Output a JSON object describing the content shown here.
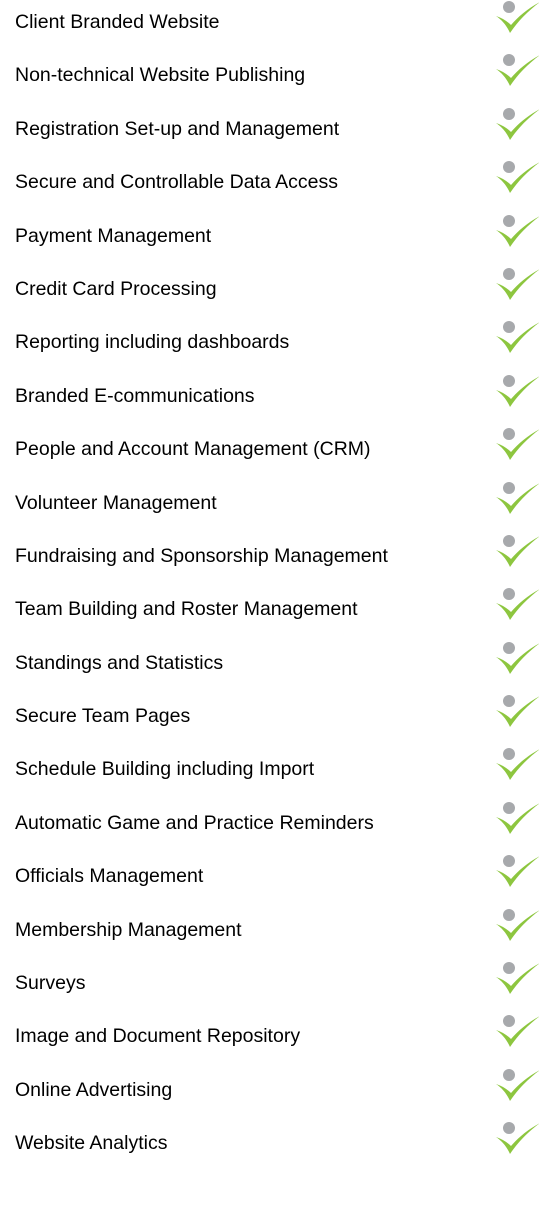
{
  "features": {
    "items": [
      {
        "label": "Client Branded Website",
        "icon": "check-icon"
      },
      {
        "label": "Non-technical Website Publishing",
        "icon": "check-icon"
      },
      {
        "label": "Registration Set-up and Management",
        "icon": "check-icon"
      },
      {
        "label": "Secure and Controllable Data Access",
        "icon": "check-icon"
      },
      {
        "label": "Payment Management",
        "icon": "check-icon"
      },
      {
        "label": "Credit Card Processing",
        "icon": "check-icon"
      },
      {
        "label": "Reporting including dashboards",
        "icon": "check-icon"
      },
      {
        "label": "Branded E-communications",
        "icon": "check-icon"
      },
      {
        "label": "People and Account Management (CRM)",
        "icon": "check-icon"
      },
      {
        "label": "Volunteer Management",
        "icon": "check-icon"
      },
      {
        "label": "Fundraising and Sponsorship Management",
        "icon": "check-icon"
      },
      {
        "label": "Team Building and Roster Management",
        "icon": "check-icon"
      },
      {
        "label": "Standings and Statistics",
        "icon": "check-icon"
      },
      {
        "label": "Secure Team Pages",
        "icon": "check-icon"
      },
      {
        "label": "Schedule Building including Import",
        "icon": "check-icon"
      },
      {
        "label": "Automatic Game and Practice Reminders",
        "icon": "check-icon"
      },
      {
        "label": "Officials Management",
        "icon": "check-icon"
      },
      {
        "label": "Membership Management",
        "icon": "check-icon"
      },
      {
        "label": "Surveys",
        "icon": "check-icon"
      },
      {
        "label": "Image and Document Repository",
        "icon": "check-icon"
      },
      {
        "label": "Online Advertising",
        "icon": "check-icon"
      },
      {
        "label": "Website Analytics",
        "icon": "check-icon"
      }
    ]
  },
  "colors": {
    "check_green": "#8dc63f",
    "dot_gray": "#a7a9ac",
    "text": "#000000"
  }
}
